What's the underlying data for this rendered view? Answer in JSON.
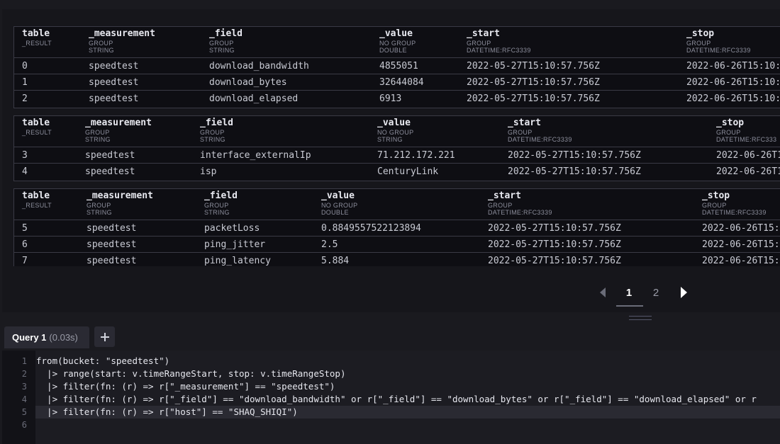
{
  "tables": [
    {
      "columns": [
        {
          "name": "table",
          "group": "_RESULT",
          "type": ""
        },
        {
          "name": "_measurement",
          "group": "GROUP",
          "type": "STRING"
        },
        {
          "name": "_field",
          "group": "GROUP",
          "type": "STRING"
        },
        {
          "name": "_value",
          "group": "NO GROUP",
          "type": "DOUBLE"
        },
        {
          "name": "_start",
          "group": "GROUP",
          "type": "DATETIME:RFC3339"
        },
        {
          "name": "_stop",
          "group": "GROUP",
          "type": "DATETIME:RFC3339"
        }
      ],
      "rows": [
        [
          "0",
          "speedtest",
          "download_bandwidth",
          "4855051",
          "2022-05-27T15:10:57.756Z",
          "2022-06-26T15:10:"
        ],
        [
          "1",
          "speedtest",
          "download_bytes",
          "32644084",
          "2022-05-27T15:10:57.756Z",
          "2022-06-26T15:10:"
        ],
        [
          "2",
          "speedtest",
          "download_elapsed",
          "6913",
          "2022-05-27T15:10:57.756Z",
          "2022-06-26T15:10:"
        ]
      ]
    },
    {
      "columns": [
        {
          "name": "table",
          "group": "_RESULT",
          "type": ""
        },
        {
          "name": "_measurement",
          "group": "GROUP",
          "type": "STRING"
        },
        {
          "name": "_field",
          "group": "GROUP",
          "type": "STRING"
        },
        {
          "name": "_value",
          "group": "NO GROUP",
          "type": "STRING"
        },
        {
          "name": "_start",
          "group": "GROUP",
          "type": "DATETIME:RFC3339"
        },
        {
          "name": "_stop",
          "group": "GROUP",
          "type": "DATETIME:RFC333"
        }
      ],
      "rows": [
        [
          "3",
          "speedtest",
          "interface_externalIp",
          "71.212.172.221",
          "2022-05-27T15:10:57.756Z",
          "2022-06-26T1"
        ],
        [
          "4",
          "speedtest",
          "isp",
          "CenturyLink",
          "2022-05-27T15:10:57.756Z",
          "2022-06-26T1"
        ]
      ]
    },
    {
      "columns": [
        {
          "name": "table",
          "group": "_RESULT",
          "type": ""
        },
        {
          "name": "_measurement",
          "group": "GROUP",
          "type": "STRING"
        },
        {
          "name": "_field",
          "group": "GROUP",
          "type": "STRING"
        },
        {
          "name": "_value",
          "group": "NO GROUP",
          "type": "DOUBLE"
        },
        {
          "name": "_start",
          "group": "GROUP",
          "type": "DATETIME:RFC3339"
        },
        {
          "name": "_stop",
          "group": "GROUP",
          "type": "DATETIME:RFC3339"
        }
      ],
      "rows": [
        [
          "5",
          "speedtest",
          "packetLoss",
          "0.8849557522123894",
          "2022-05-27T15:10:57.756Z",
          "2022-06-26T15:"
        ],
        [
          "6",
          "speedtest",
          "ping_jitter",
          "2.5",
          "2022-05-27T15:10:57.756Z",
          "2022-06-26T15:"
        ],
        [
          "7",
          "speedtest",
          "ping_latency",
          "5.884",
          "2022-05-27T15:10:57.756Z",
          "2022-06-26T15:"
        ]
      ]
    }
  ],
  "pagination": {
    "prev_icon": "chevron-left-icon",
    "next_icon": "chevron-right-icon",
    "pages": [
      "1",
      "2"
    ],
    "current": "1"
  },
  "query_tab": {
    "name": "Query 1",
    "time": "(0.03s)"
  },
  "add_query_icon": "plus-icon",
  "editor": {
    "lines": [
      {
        "num": "1",
        "code": "from(bucket: \"speedtest\")"
      },
      {
        "num": "2",
        "code": "  |> range(start: v.timeRangeStart, stop: v.timeRangeStop)"
      },
      {
        "num": "3",
        "code": "  |> filter(fn: (r) => r[\"_measurement\"] == \"speedtest\")"
      },
      {
        "num": "4",
        "code": "  |> filter(fn: (r) => r[\"_field\"] == \"download_bandwidth\" or r[\"_field\"] == \"download_bytes\" or r[\"_field\"] == \"download_elapsed\" or r"
      },
      {
        "num": "5",
        "code": "  |> filter(fn: (r) => r[\"host\"] == \"SHAQ_SHIQI\")"
      },
      {
        "num": "6",
        "code": ""
      }
    ]
  }
}
